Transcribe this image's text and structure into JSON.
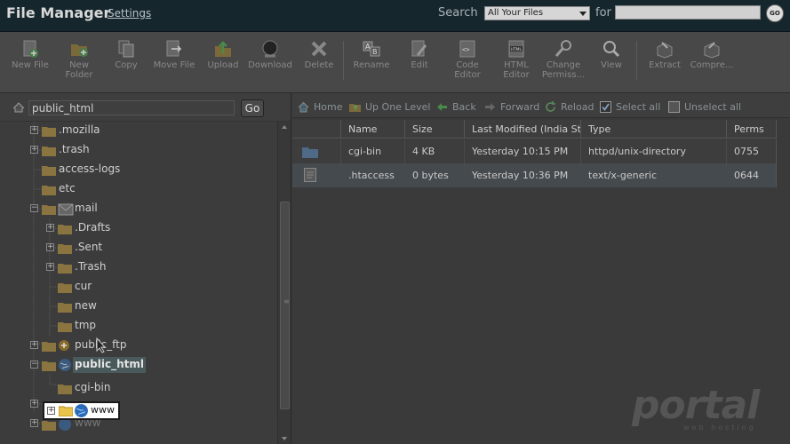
{
  "header": {
    "title": "File Manager",
    "settings": "Settings",
    "search_label": "Search",
    "search_scope": "All Your Files",
    "for_label": "for",
    "search_value": "",
    "go": "GO"
  },
  "toolbar": [
    {
      "label": "New File",
      "icon": "new-file-icon"
    },
    {
      "label": "New\nFolder",
      "icon": "new-folder-icon"
    },
    {
      "label": "Copy",
      "icon": "copy-icon"
    },
    {
      "label": "Move File",
      "icon": "move-file-icon"
    },
    {
      "label": "Upload",
      "icon": "upload-icon"
    },
    {
      "label": "Download",
      "icon": "download-icon"
    },
    {
      "label": "Delete",
      "icon": "delete-icon"
    },
    {
      "label": "Rename",
      "icon": "rename-icon"
    },
    {
      "label": "Edit",
      "icon": "edit-icon"
    },
    {
      "label": "Code\nEditor",
      "icon": "code-editor-icon"
    },
    {
      "label": "HTML\nEditor",
      "icon": "html-editor-icon"
    },
    {
      "label": "Change\nPermiss...",
      "icon": "permissions-icon"
    },
    {
      "label": "View",
      "icon": "view-icon"
    },
    {
      "label": "Extract",
      "icon": "extract-icon"
    },
    {
      "label": "Compre...",
      "icon": "compress-icon"
    }
  ],
  "path": {
    "value": "public_html",
    "go": "Go"
  },
  "tree": [
    {
      "label": ".mozilla"
    },
    {
      "label": ".trash"
    },
    {
      "label": "access-logs"
    },
    {
      "label": "etc"
    },
    {
      "label": "mail"
    },
    {
      "label": ".Drafts"
    },
    {
      "label": ".Sent"
    },
    {
      "label": ".Trash"
    },
    {
      "label": "cur"
    },
    {
      "label": "new"
    },
    {
      "label": "tmp"
    },
    {
      "label": "public_ftp"
    },
    {
      "label": "public_html"
    },
    {
      "label": "cgi-bin"
    },
    {
      "label": "www"
    },
    {
      "label": "www"
    }
  ],
  "nav": {
    "home": "Home",
    "up": "Up One Level",
    "back": "Back",
    "forward": "Forward",
    "reload": "Reload",
    "select_all": "Select all",
    "unselect_all": "Unselect all"
  },
  "table": {
    "headers": [
      "",
      "Name",
      "Size",
      "Last Modified (India Standard Time)",
      "Type",
      "Perms"
    ],
    "rows": [
      {
        "name": "cgi-bin",
        "size": "4 KB",
        "modified": "Yesterday 10:15 PM",
        "type": "httpd/unix-directory",
        "perms": "0755"
      },
      {
        "name": ".htaccess",
        "size": "0 bytes",
        "modified": "Yesterday 10:36 PM",
        "type": "text/x-generic",
        "perms": "0644"
      }
    ]
  },
  "watermark": {
    "brand": "portal",
    "sub": "web hosting"
  },
  "colors": {
    "header_bg": "#16262d",
    "accent": "#6a3a3a"
  }
}
